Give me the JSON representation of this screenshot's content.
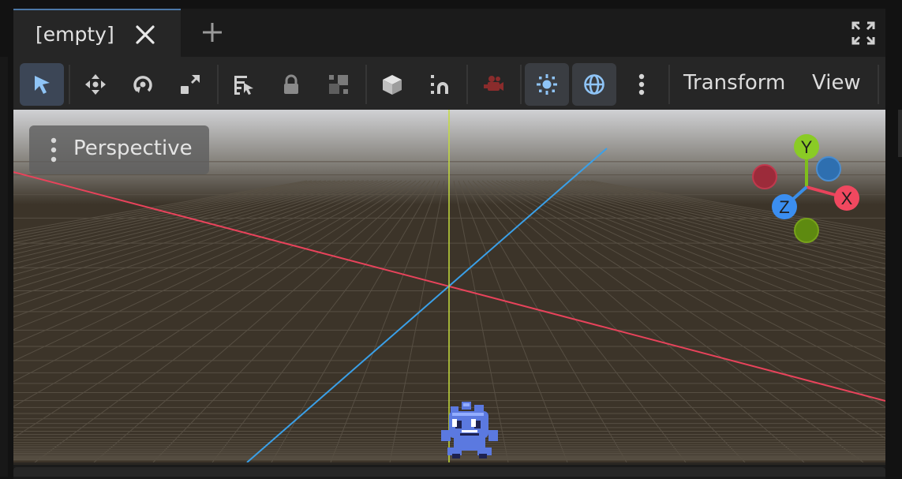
{
  "scene_tab": {
    "label": "[empty]",
    "close_icon": "close-icon"
  },
  "add_tab_icon": "plus-icon",
  "fullscreen_icon": "fullscreen-icon",
  "toolbar": {
    "tools": [
      {
        "icon": "select-pointer-icon",
        "active": true
      },
      {
        "icon": "move-icon"
      },
      {
        "icon": "rotate-icon"
      },
      {
        "icon": "scale-icon"
      },
      {
        "icon": "list-select-icon"
      },
      {
        "icon": "lock-icon"
      },
      {
        "icon": "group-icon"
      },
      {
        "icon": "cube-icon"
      },
      {
        "icon": "snap-icon"
      },
      {
        "icon": "camera-icon"
      },
      {
        "icon": "sun-icon",
        "toggled": true
      },
      {
        "icon": "globe-icon",
        "toggled": true
      },
      {
        "icon": "more-vertical-icon"
      }
    ],
    "menus": {
      "transform": "Transform",
      "view": "View"
    }
  },
  "viewport": {
    "perspective_label": "Perspective",
    "gizmo": {
      "x_label": "X",
      "y_label": "Y",
      "z_label": "Z"
    },
    "colors": {
      "x_axis": "#e8435b",
      "y_axis": "#c4dc3c",
      "z_axis": "#3aa0e8",
      "background": "#3c3429"
    }
  }
}
